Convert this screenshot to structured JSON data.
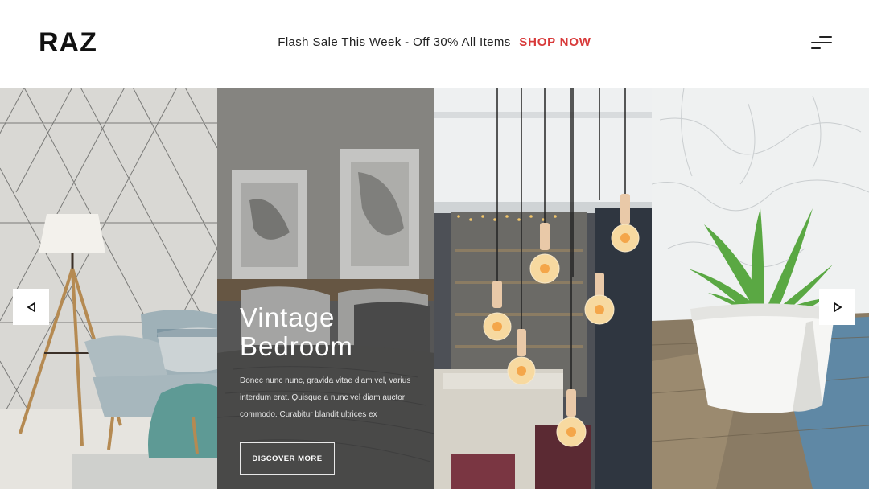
{
  "header": {
    "logo": "RAZ",
    "promo_text": "Flash Sale This Week - Off 30% All Items",
    "promo_cta": "SHOP NOW",
    "menu_icon": "hamburger-menu-icon"
  },
  "slider": {
    "prev_icon": "chevron-left-icon",
    "next_icon": "chevron-right-icon",
    "featured": {
      "title_line1": "Vintage",
      "title_line2": "Bedroom",
      "body": "Donec nunc nunc, gravida vitae diam vel, varius interdum erat. Quisque a nunc vel diam auctor commodo. Curabitur blandit ultrices ex",
      "button_label": "DISCOVER MORE"
    }
  },
  "colors": {
    "accent": "#d83a3a",
    "text": "#1a1a1a",
    "background": "#ffffff"
  }
}
